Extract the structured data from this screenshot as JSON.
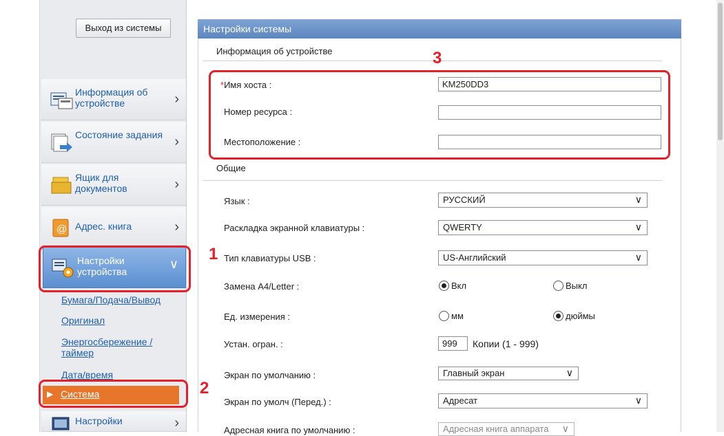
{
  "sidebar": {
    "logout_label": "Выход из системы",
    "items": [
      {
        "label": "Информация об устройстве",
        "icon": "device-info-icon"
      },
      {
        "label": "Состояние задания",
        "icon": "job-status-icon"
      },
      {
        "label": "Ящик для документов",
        "icon": "document-box-icon"
      },
      {
        "label": "Адрес. книга",
        "icon": "address-book-icon"
      }
    ],
    "settings": {
      "label": "Настройки устройства",
      "icon": "device-settings-icon"
    },
    "sub_links": [
      "Бумага/Подача/Вывод",
      "Оригинал",
      "Энергосбережение / таймер",
      "Дата/время"
    ],
    "active_sub": "Система",
    "next_item": {
      "label": "Настройки",
      "icon": "function-settings-icon"
    }
  },
  "panel": {
    "title": "Настройки системы",
    "device_info_section": "Информация об устройстве",
    "host_label_mark": "*",
    "host_label": "Имя хоста :",
    "host_value": "KM250DD3",
    "asset_label": "Номер ресурса :",
    "asset_value": "",
    "location_label": "Местоположение :",
    "location_value": "",
    "general_section": "Общие",
    "language_label": "Язык :",
    "language_value": "РУССКИЙ",
    "keyboard_layout_label": "Раскладка экранной клавиатуры :",
    "keyboard_layout_value": "QWERTY",
    "usb_keyboard_label": "Тип клавиатуры USB :",
    "usb_keyboard_value": "US-Английский",
    "a4letter_label": "Замена A4/Letter :",
    "a4letter_on": "Вкл",
    "a4letter_off": "Выкл",
    "units_label": "Ед. измерения :",
    "units_mm": "мм",
    "units_inch": "дюймы",
    "limit_label": "Устан. огран. :",
    "limit_value": "999",
    "limit_suffix": "Копии (1 - 999)",
    "default_screen_label": "Экран по умолчанию :",
    "default_screen_value": "Главный экран",
    "default_screen_send_label": "Экран по умолч (Перед.) :",
    "default_screen_send_value": "Адресат",
    "default_addrbook_label": "Адресная книга по умолчанию :",
    "default_addrbook_value": "Адресная книга аппарата"
  },
  "callouts": [
    "1",
    "2",
    "3"
  ],
  "colors": {
    "accent_red": "#e5202a",
    "active_orange": "#e8762a",
    "header_blue": "#5d86bf",
    "link_blue": "#1f5fb3"
  }
}
